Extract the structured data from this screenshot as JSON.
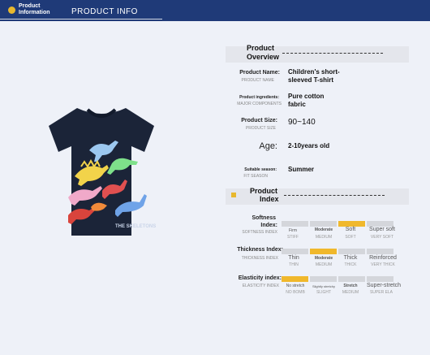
{
  "header": {
    "label_line1": "Product",
    "label_line2": "Information",
    "title": "PRODUCT INFO",
    "accent": "#e8b82e",
    "bar_color": "#1f3a78"
  },
  "overview": {
    "heading_line1": "Product",
    "heading_line2": "Overview",
    "rows": [
      {
        "label": "Product Name:",
        "sub": "PRODUCT NAME",
        "value_line1": "Children's short-",
        "value_line2": "sleeved T-shirt"
      },
      {
        "label": "Product ingredients:",
        "sub": "MAJOR COMPONENTS",
        "value_line1": "Pure cotton",
        "value_line2": "fabric"
      },
      {
        "label": "Product Size:",
        "sub": "PRODUCT SIZE",
        "value_line1": "90~140"
      },
      {
        "label": "Age:",
        "sub": "",
        "value_line1": "2-10years old"
      },
      {
        "label": "Suitable season:",
        "sub": "FIT SEASON",
        "value_line1": "Summer"
      }
    ]
  },
  "index": {
    "heading_line1": "Product",
    "heading_line2": "Index",
    "scales": [
      {
        "label_line1": "Softness",
        "label_line2": "Index:",
        "sub": "SOFTNESS INDEX",
        "active": 2,
        "options": [
          {
            "en": "Firm",
            "sub": "STIFF"
          },
          {
            "en": "Moderate",
            "sub": "MEDIUM"
          },
          {
            "en": "Soft",
            "sub": "SOFT"
          },
          {
            "en": "Super soft",
            "sub": "VERY SOFT"
          }
        ]
      },
      {
        "label_line1": "Thickness Index:",
        "label_line2": "",
        "sub": "THICKNESS INDEX",
        "active": 1,
        "options": [
          {
            "en": "Thin",
            "sub": "THIN"
          },
          {
            "en": "Moderate",
            "sub": "MEDIUM"
          },
          {
            "en": "Thick",
            "sub": "THICK"
          },
          {
            "en": "Reinforced",
            "sub": "VERY THICK"
          }
        ]
      },
      {
        "label_line1": "Elasticity index:",
        "label_line2": "",
        "sub": "ELASTICITY INDEX",
        "active": 0,
        "options": [
          {
            "en": "No stretch",
            "sub": "NO BOMB"
          },
          {
            "en": "Slightly stretchy",
            "sub": "SLIGHT"
          },
          {
            "en": "Stretch",
            "sub": "MEDIUM"
          },
          {
            "en": "Super-stretch",
            "sub": "SUPER ELA"
          }
        ]
      }
    ]
  },
  "product_image": {
    "description_icon": "tshirt-icon",
    "shirt_color": "#1b2438",
    "print_text": "THE SKELETONS"
  }
}
